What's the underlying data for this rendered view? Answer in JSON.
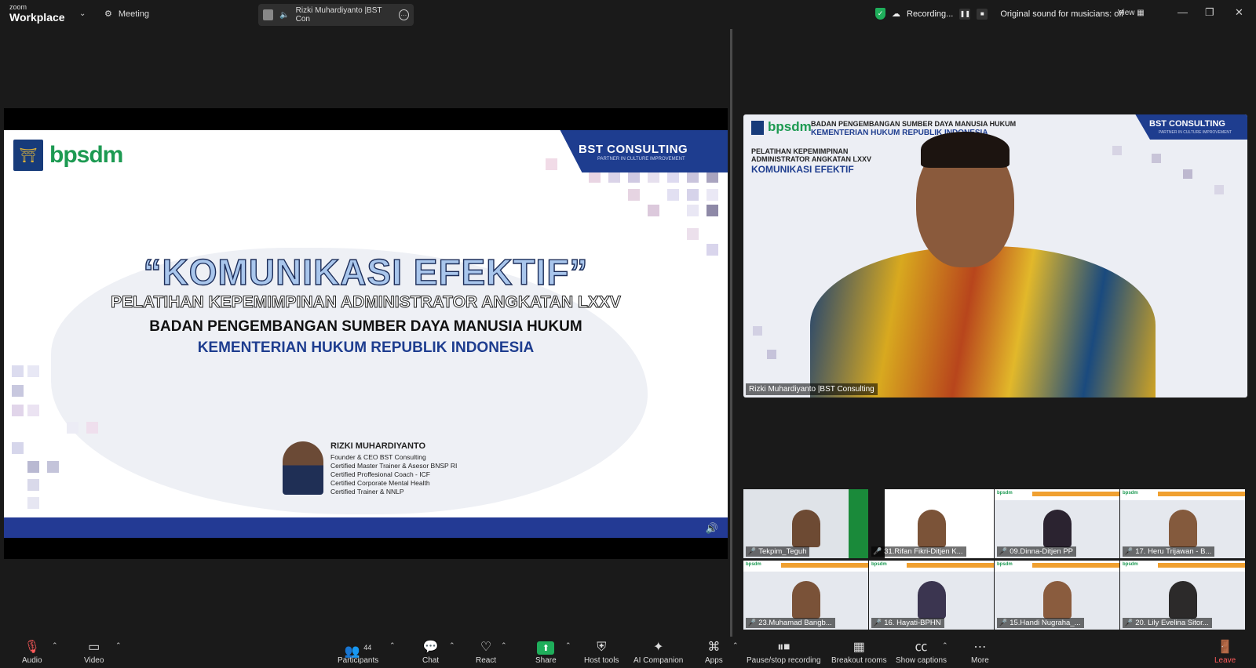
{
  "app": {
    "brand_small": "zoom",
    "brand_name": "Workplace"
  },
  "header": {
    "meeting_label": "Meeting",
    "active_speaker": "Rizki Muhardiyanto |BST Con",
    "recording_label": "Recording...",
    "audio_mode": "Original sound for musicians: off",
    "view_label": "View"
  },
  "slide": {
    "logo_text": "bpsdm",
    "bst_title": "BST CONSULTING",
    "bst_tagline": "PARTNER IN CULTURE IMPROVEMENT",
    "title": "“KOMUNIKASI EFEKTIF”",
    "subtitle": "PELATIHAN KEPEMIMPINAN ADMINISTRATOR ANGKATAN LXXV",
    "line3": "BADAN PENGEMBANGAN SUMBER DAYA MANUSIA HUKUM",
    "line4": "KEMENTERIAN HUKUM REPUBLIK INDONESIA",
    "presenter_name": "RIZKI MUHARDIYANTO",
    "presenter_lines": [
      "Founder & CEO BST Consulting",
      "Certified  Master Trainer & Asesor BNSP RI",
      "Certified Proffesional Coach - ICF",
      "Certified Corporate Mental Health",
      "Certified Trainer & NNLP"
    ]
  },
  "speaker": {
    "bg_h1": "BADAN PENGEMBANGAN SUMBER DAYA MANUSIA HUKUM",
    "bg_h2": "KEMENTERIAN HUKUM REPUBLIK INDONESIA",
    "bg_t1": "PELATIHAN KEPEMIMPINAN",
    "bg_t2": "ADMINISTRATOR ANGKATAN LXXV",
    "bg_t3": "KOMUNIKASI EFEKTIF",
    "name": "Rizki Muhardiyanto |BST Consulting"
  },
  "gallery": [
    {
      "name": "Tekpim_Teguh"
    },
    {
      "name": "31.Rifan Fikri-Ditjen K..."
    },
    {
      "name": "09.Dinna-Ditjen PP"
    },
    {
      "name": "17. Heru Trijawan - B..."
    },
    {
      "name": "23.Muhamad Bangb..."
    },
    {
      "name": "16. Hayati-BPHN"
    },
    {
      "name": "15.Handi Nugraha_..."
    },
    {
      "name": "20. Lily Evelina Sitor..."
    }
  ],
  "toolbar": {
    "audio": "Audio",
    "video": "Video",
    "participants": "Participants",
    "participants_count": "44",
    "chat": "Chat",
    "react": "React",
    "share": "Share",
    "host_tools": "Host tools",
    "ai_companion": "AI Companion",
    "apps": "Apps",
    "pause_stop": "Pause/stop recording",
    "breakout": "Breakout rooms",
    "captions": "Show captions",
    "more": "More",
    "leave": "Leave"
  },
  "colors": {
    "accent_green": "#1fae5b",
    "brand_blue": "#1e3d8f",
    "leave_red": "#ff5a5a"
  }
}
